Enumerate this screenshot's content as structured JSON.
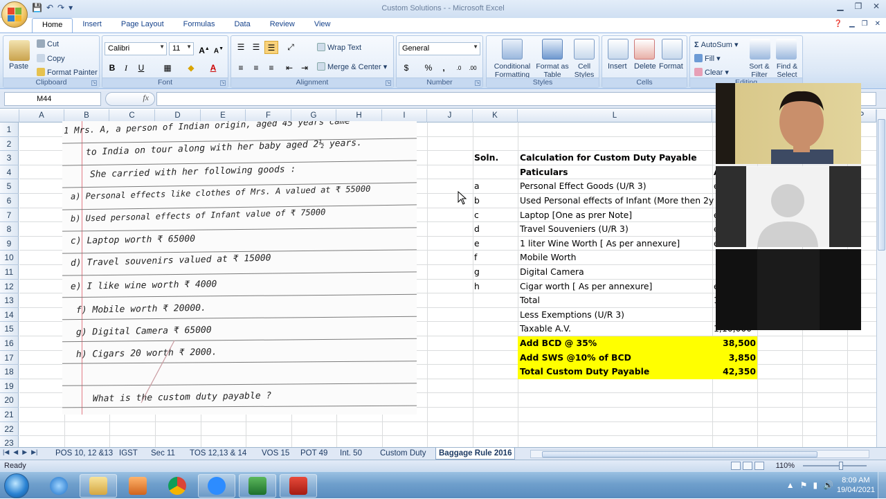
{
  "window": {
    "title": "Custom Solutions - - Microsoft Excel"
  },
  "ribbon": {
    "tabs": [
      "Home",
      "Insert",
      "Page Layout",
      "Formulas",
      "Data",
      "Review",
      "View"
    ],
    "clipboard": {
      "paste": "Paste",
      "cut": "Cut",
      "copy": "Copy",
      "format_painter": "Format Painter",
      "label": "Clipboard"
    },
    "font": {
      "name": "Calibri",
      "size": "11",
      "label": "Font"
    },
    "alignment": {
      "wrap_text": "Wrap Text",
      "merge_center": "Merge & Center",
      "label": "Alignment"
    },
    "number": {
      "format": "General",
      "label": "Number"
    },
    "styles": {
      "conditional": "Conditional Formatting",
      "format_table": "Format as Table",
      "cell_styles": "Cell Styles",
      "label": "Styles"
    },
    "cells": {
      "insert": "Insert",
      "delete": "Delete",
      "format": "Format",
      "label": "Cells"
    },
    "editing": {
      "autosum": "AutoSum",
      "fill": "Fill",
      "clear": "Clear",
      "sort_filter": "Sort & Filter",
      "find_select": "Find & Select",
      "label": "Editing"
    }
  },
  "formula_bar": {
    "name_box": "M44",
    "fx": "fx",
    "formula": ""
  },
  "columns": [
    "A",
    "B",
    "C",
    "D",
    "E",
    "F",
    "G",
    "H",
    "I",
    "J",
    "K",
    "L",
    "P"
  ],
  "rows": [
    "1",
    "2",
    "3",
    "4",
    "5",
    "6",
    "7",
    "8",
    "9",
    "10",
    "11",
    "12",
    "13",
    "14",
    "15",
    "16",
    "17",
    "18",
    "19",
    "20",
    "21",
    "22",
    "23"
  ],
  "handwritten": {
    "line1": "1   Mrs. A, a person of Indian origin, aged 45 years came",
    "line2": "to India on tour along with her baby aged 2½ years.",
    "line3": "She carried with her following goods :",
    "line4": "a) Personal effects like clothes of Mrs. A valued at ₹ 55000",
    "line5": "b) Used personal effects of Infant value of ₹ 75000",
    "line6": "c) Laptop worth ₹ 65000",
    "line7": "d) Travel souvenirs valued at ₹ 15000",
    "line8": "e)  I  like wine worth ₹ 4000",
    "line9": "f) Mobile worth ₹ 20000.",
    "line10": "g) Digital Camera ₹ 65000",
    "line11": "h) Cigars 20 worth ₹ 2000.",
    "line12": "What is the custom duty payable ?"
  },
  "solution": {
    "label": "Soln.",
    "title": "Calculation for Custom Duty Payable",
    "header": "Paticulars",
    "header_partial": "A",
    "items": [
      {
        "key": "a",
        "text": "Personal Effect Goods (U/R 3)",
        "partial": "e"
      },
      {
        "key": "b",
        "text": "Used Personal effects of Infant (More then 2y",
        "partial": ""
      },
      {
        "key": "c",
        "text": "Laptop [One as prer Note]",
        "partial": "e"
      },
      {
        "key": "d",
        "text": "Travel Souveniers (U/R 3)",
        "partial": "e"
      },
      {
        "key": "e",
        "text": "1 liter Wine Worth [ As per annexure]",
        "partial": "e"
      },
      {
        "key": "f",
        "text": "Mobile Worth",
        "partial": ""
      },
      {
        "key": "g",
        "text": "Digital Camera",
        "partial": ""
      },
      {
        "key": "h",
        "text": "Cigar worth  [ As per annexure]",
        "partial": "e"
      }
    ],
    "total": "Total",
    "total_partial": "1",
    "less": "Less Exemptions (U/R 3)",
    "taxable": "Taxable A.V.",
    "taxable_value": "1,10,000",
    "bcd_label": "Add BCD @ 35%",
    "bcd_value": "38,500",
    "sws_label": "Add SWS @10% of BCD",
    "sws_value": "3,850",
    "total_duty_label": "Total Custom Duty Payable",
    "total_duty_value": "42,350"
  },
  "sheets": [
    "POS 10, 12 &13",
    "IGST",
    "Sec 11",
    "TOS 12,13 & 14",
    "VOS 15",
    "POT 49",
    "Int. 50",
    "Custom Duty",
    "Baggage Rule 2016"
  ],
  "active_sheet": "Baggage Rule 2016",
  "status": {
    "ready": "Ready",
    "zoom": "110%"
  },
  "taskbar": {
    "time": "8:09 AM",
    "date": "19/04/2021"
  },
  "colors": {
    "highlight": "#ffff00",
    "ribbon": "#dbe7f6"
  }
}
